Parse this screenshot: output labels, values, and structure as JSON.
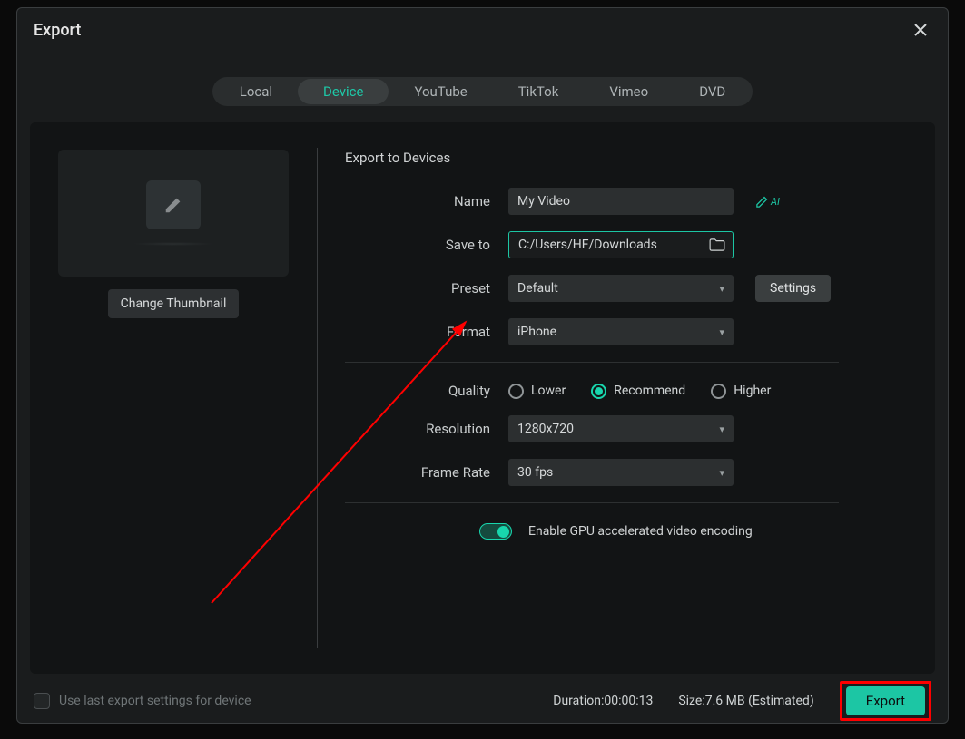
{
  "dialog": {
    "title": "Export"
  },
  "tabs": {
    "items": [
      "Local",
      "Device",
      "YouTube",
      "TikTok",
      "Vimeo",
      "DVD"
    ],
    "active": 1
  },
  "thumbnail": {
    "change_label": "Change Thumbnail"
  },
  "section": {
    "title": "Export to Devices"
  },
  "fields": {
    "name": {
      "label": "Name",
      "value": "My Video"
    },
    "save_to": {
      "label": "Save to",
      "value": "C:/Users/HF/Downloads"
    },
    "preset": {
      "label": "Preset",
      "value": "Default",
      "settings_label": "Settings"
    },
    "format": {
      "label": "Format",
      "value": "iPhone"
    },
    "quality": {
      "label": "Quality",
      "options": [
        "Lower",
        "Recommend",
        "Higher"
      ],
      "selected": 1
    },
    "resolution": {
      "label": "Resolution",
      "value": "1280x720"
    },
    "frame_rate": {
      "label": "Frame Rate",
      "value": "30 fps"
    },
    "gpu": {
      "label": "Enable GPU accelerated video encoding",
      "on": true
    }
  },
  "footer": {
    "use_last_label": "Use last export settings for device",
    "duration_label": "Duration:",
    "duration_value": "00:00:13",
    "size_label": "Size:",
    "size_value": "7.6 MB",
    "size_suffix": "(Estimated)",
    "export_label": "Export"
  },
  "icons": {
    "ai_suffix": "AI"
  }
}
